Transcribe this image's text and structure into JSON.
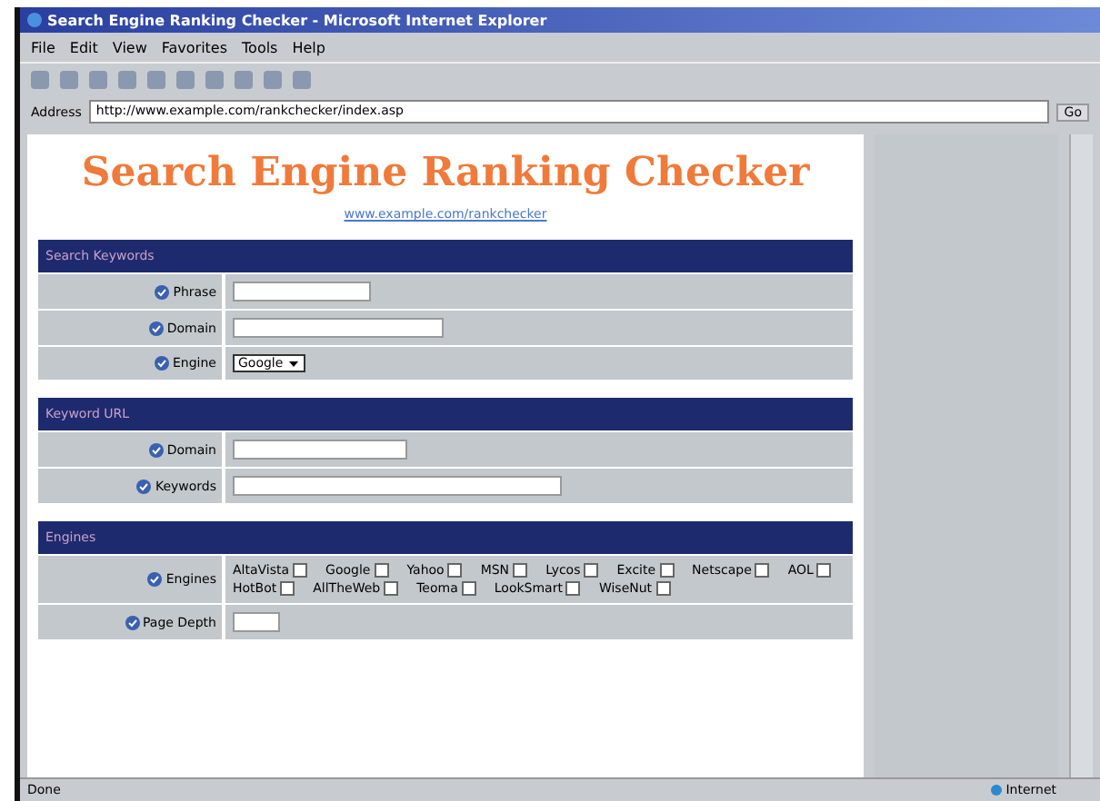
{
  "window": {
    "title": "Search Engine Ranking Checker - Microsoft Internet Explorer"
  },
  "menu": [
    "File",
    "Edit",
    "View",
    "Favorites",
    "Tools",
    "Help"
  ],
  "address": {
    "label": "Address",
    "value": "http://www.example.com/rankchecker/index.asp",
    "go": "Go"
  },
  "page": {
    "heading": "Search Engine Ranking Checker",
    "link": "www.example.com/rankchecker",
    "sections": [
      {
        "title": "Search Keywords",
        "rows": [
          {
            "label": "Phrase",
            "kind": "text"
          },
          {
            "label": "Domain",
            "kind": "text"
          },
          {
            "label": "Engine",
            "kind": "select",
            "value": "Google"
          }
        ]
      },
      {
        "title": "Keyword URL",
        "rows": [
          {
            "label": "Domain",
            "kind": "text"
          },
          {
            "label": "Keywords",
            "kind": "text"
          }
        ]
      },
      {
        "title": "Engines",
        "rows": [
          {
            "label": "Engines",
            "kind": "checks",
            "options": [
              {
                "label": "AltaVista",
                "checked": false
              },
              {
                "label": "Google",
                "checked": false
              },
              {
                "label": "Yahoo",
                "checked": false
              },
              {
                "label": "MSN",
                "checked": false
              },
              {
                "label": "Lycos",
                "checked": false
              },
              {
                "label": "Excite",
                "checked": false
              },
              {
                "label": "Netscape",
                "checked": false
              },
              {
                "label": "AOL",
                "checked": false
              },
              {
                "label": "HotBot",
                "checked": false
              },
              {
                "label": "AllTheWeb",
                "checked": false
              },
              {
                "label": "Teoma",
                "checked": false
              },
              {
                "label": "LookSmart",
                "checked": false
              },
              {
                "label": "WiseNut",
                "checked": false
              }
            ]
          },
          {
            "label": "Page Depth",
            "kind": "text"
          }
        ]
      }
    ]
  },
  "status_bar": {
    "text": "Done",
    "zone": "Internet"
  }
}
